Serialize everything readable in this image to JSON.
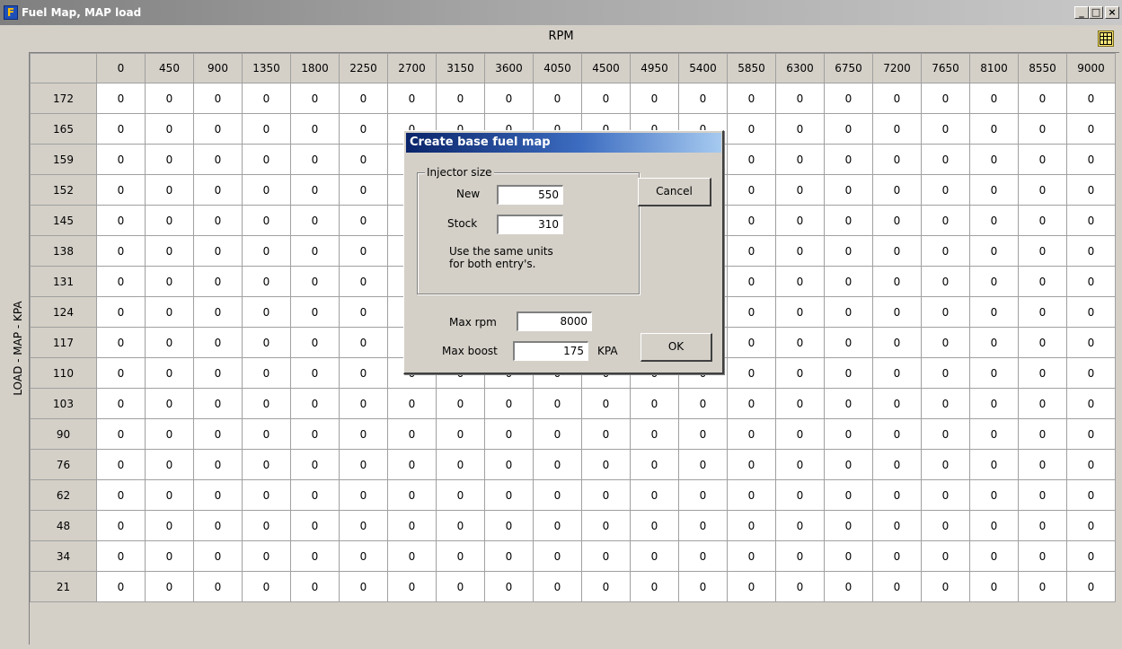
{
  "window": {
    "title": "Fuel Map, MAP load",
    "buttons": {
      "minimize": "_",
      "maximize": "□",
      "close": "×"
    },
    "icon": "fuel-app-icon"
  },
  "grid": {
    "x_label": "RPM",
    "y_label": "LOAD - MAP - KPA",
    "rpm_values": [
      "0",
      "450",
      "900",
      "1350",
      "1800",
      "2250",
      "2700",
      "3150",
      "3600",
      "4050",
      "4500",
      "4950",
      "5400",
      "5850",
      "6300",
      "6750",
      "7200",
      "7650",
      "8100",
      "8550",
      "9000"
    ],
    "load_values": [
      "172",
      "165",
      "159",
      "152",
      "145",
      "138",
      "131",
      "124",
      "117",
      "110",
      "103",
      "90",
      "76",
      "62",
      "48",
      "34",
      "21"
    ],
    "cell_value": "0",
    "grid_icon": "grid-settings-icon"
  },
  "dialog": {
    "title": "Create base fuel map",
    "injector_group_label": "Injector size",
    "new_label": "New",
    "new_value": "550",
    "stock_label": "Stock",
    "stock_value": "310",
    "note_line1": "Use the same units",
    "note_line2": "for both entry's.",
    "max_rpm_label": "Max rpm",
    "max_rpm_value": "8000",
    "max_boost_label": "Max boost",
    "max_boost_value": "175",
    "max_boost_unit": "KPA",
    "cancel_label": "Cancel",
    "ok_label": "OK"
  }
}
